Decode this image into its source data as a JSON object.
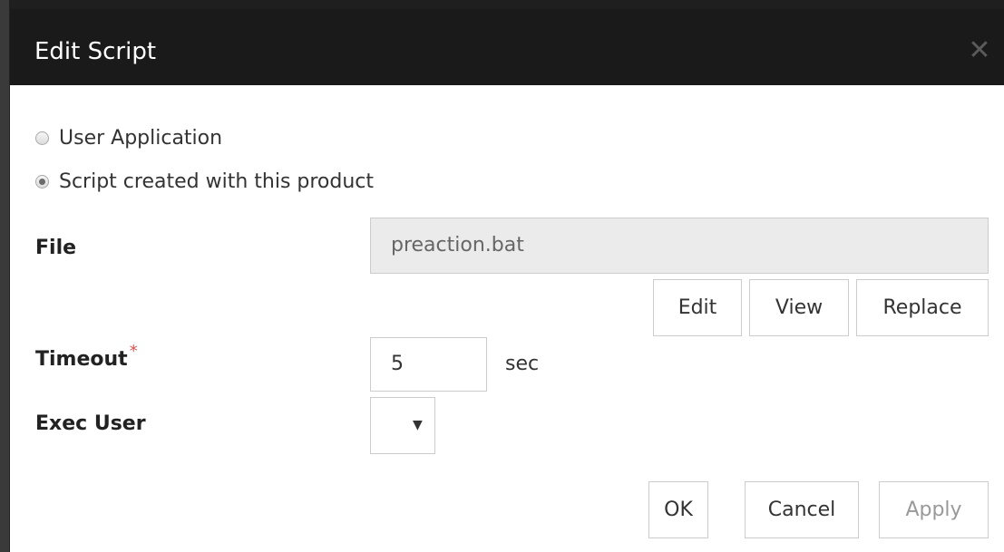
{
  "dialog": {
    "title": "Edit Script",
    "close_symbol": "✕"
  },
  "options": {
    "user_application": {
      "label": "User Application",
      "selected": false
    },
    "script_created": {
      "label": "Script created with this product",
      "selected": true
    }
  },
  "file": {
    "label": "File",
    "value": "preaction.bat",
    "buttons": {
      "edit": "Edit",
      "view": "View",
      "replace": "Replace"
    }
  },
  "timeout": {
    "label": "Timeout",
    "required_mark": "*",
    "value": "5",
    "unit": "sec"
  },
  "exec_user": {
    "label": "Exec User",
    "value": ""
  },
  "footer": {
    "ok": "OK",
    "cancel": "Cancel",
    "apply": "Apply"
  },
  "colors": {
    "titlebar": "#1a1a1a",
    "required": "#d9534f",
    "field_bg": "#ebebeb"
  }
}
